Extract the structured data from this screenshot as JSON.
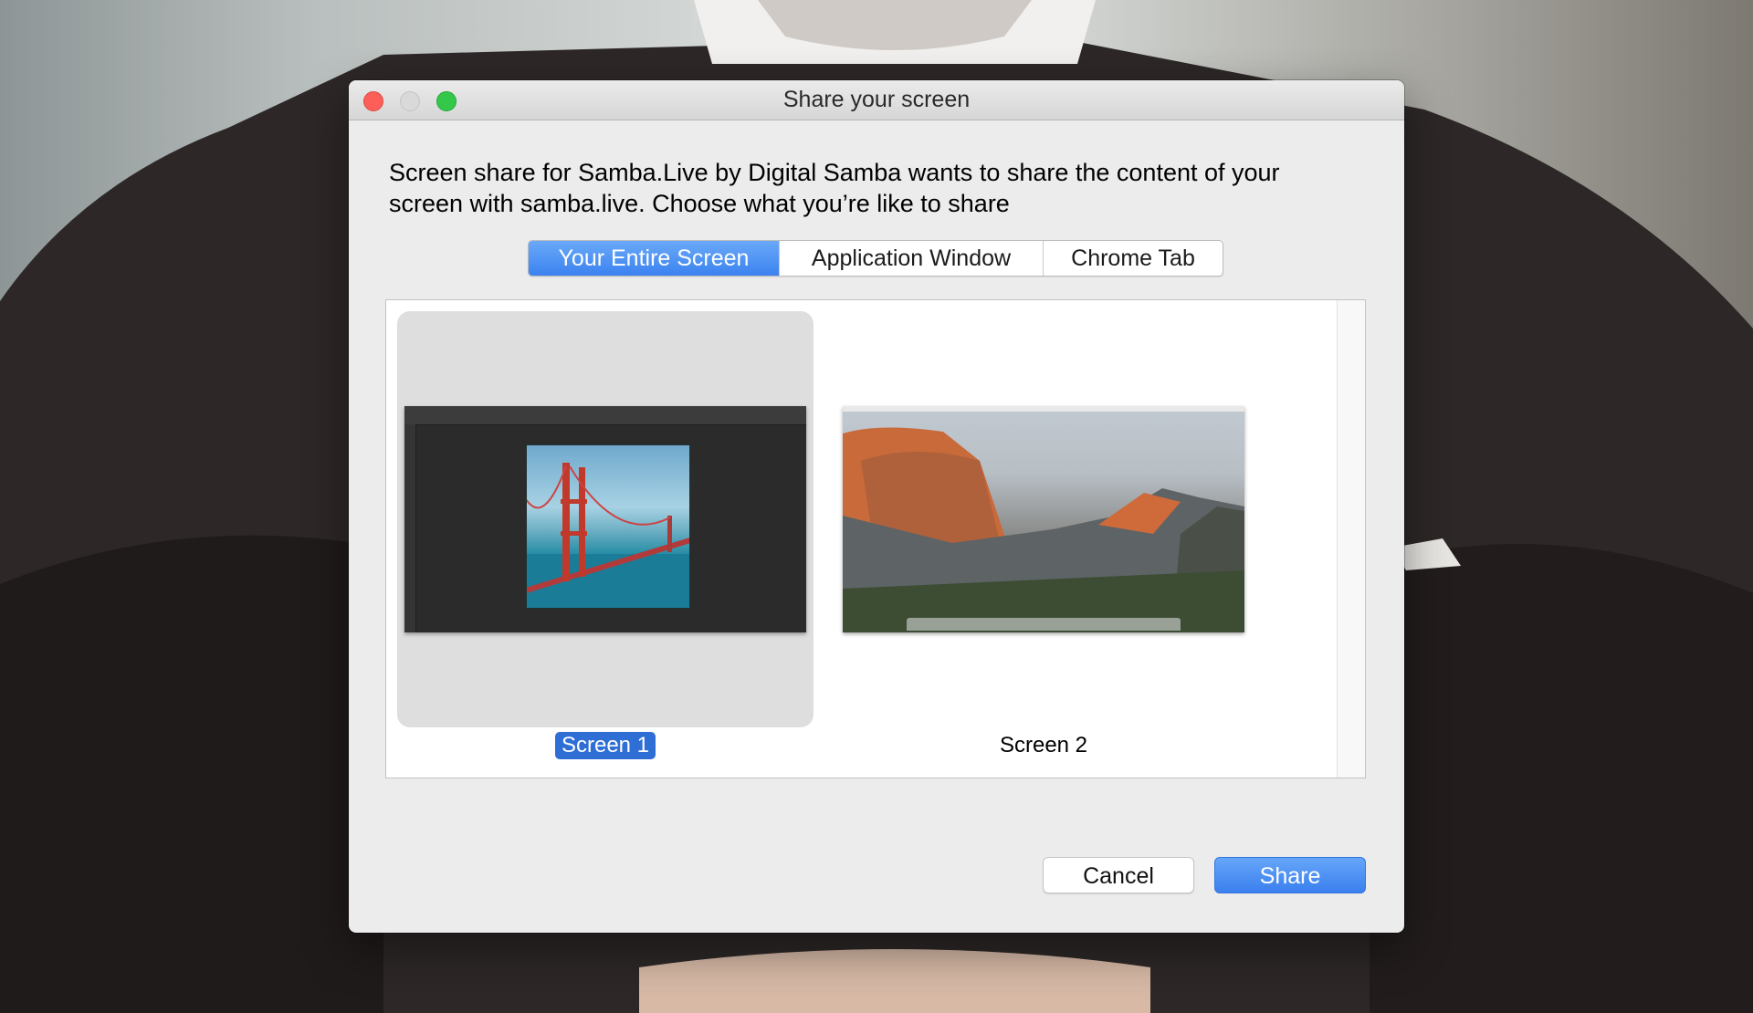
{
  "dialog": {
    "title": "Share your screen",
    "prompt": "Screen share for Samba.Live by Digital Samba wants to share the content of your screen with samba.live. Choose what you’re like to share"
  },
  "tabs": [
    {
      "label": "Your Entire Screen",
      "selected": true
    },
    {
      "label": "Application Window",
      "selected": false
    },
    {
      "label": "Chrome Tab",
      "selected": false
    }
  ],
  "screens": [
    {
      "label": "Screen 1",
      "selected": true
    },
    {
      "label": "Screen 2",
      "selected": false
    }
  ],
  "buttons": {
    "cancel": "Cancel",
    "share": "Share"
  },
  "colors": {
    "accent": "#3b82f0",
    "selection": "#2e6ed5",
    "close": "#fc5f57",
    "maximize": "#34c84a"
  }
}
